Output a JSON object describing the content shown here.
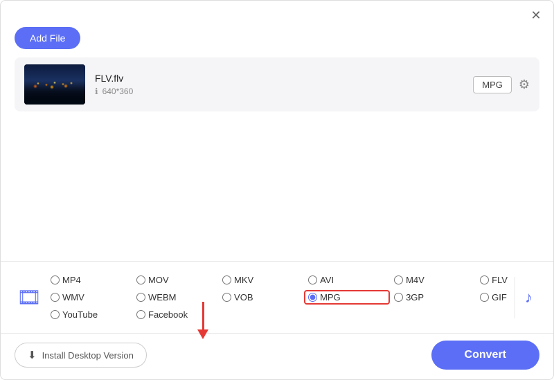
{
  "toolbar": {
    "add_file_label": "Add File"
  },
  "close": {
    "label": "×"
  },
  "file": {
    "name": "FLV.flv",
    "resolution": "640*360",
    "format_badge": "MPG"
  },
  "formats": {
    "video": [
      {
        "id": "mp4",
        "label": "MP4",
        "row": 1,
        "checked": false
      },
      {
        "id": "mov",
        "label": "MOV",
        "row": 1,
        "checked": false
      },
      {
        "id": "mkv",
        "label": "MKV",
        "row": 1,
        "checked": false
      },
      {
        "id": "avi",
        "label": "AVI",
        "row": 1,
        "checked": false
      },
      {
        "id": "m4v",
        "label": "M4V",
        "row": 1,
        "checked": false
      },
      {
        "id": "flv",
        "label": "FLV",
        "row": 1,
        "checked": false
      },
      {
        "id": "wmv",
        "label": "WMV",
        "row": 1,
        "checked": false
      },
      {
        "id": "webm",
        "label": "WEBM",
        "row": 2,
        "checked": false
      },
      {
        "id": "vob",
        "label": "VOB",
        "row": 2,
        "checked": false
      },
      {
        "id": "mpg",
        "label": "MPG",
        "row": 2,
        "checked": true
      },
      {
        "id": "3gp",
        "label": "3GP",
        "row": 2,
        "checked": false
      },
      {
        "id": "gif",
        "label": "GIF",
        "row": 2,
        "checked": false
      },
      {
        "id": "youtube",
        "label": "YouTube",
        "row": 2,
        "checked": false
      },
      {
        "id": "facebook",
        "label": "Facebook",
        "row": 2,
        "checked": false
      }
    ]
  },
  "bottom": {
    "install_label": "Install Desktop Version",
    "convert_label": "Convert"
  },
  "icons": {
    "close": "✕",
    "info": "ℹ",
    "video": "🎬",
    "music": "♪",
    "download": "⬇",
    "settings": "⚙"
  }
}
